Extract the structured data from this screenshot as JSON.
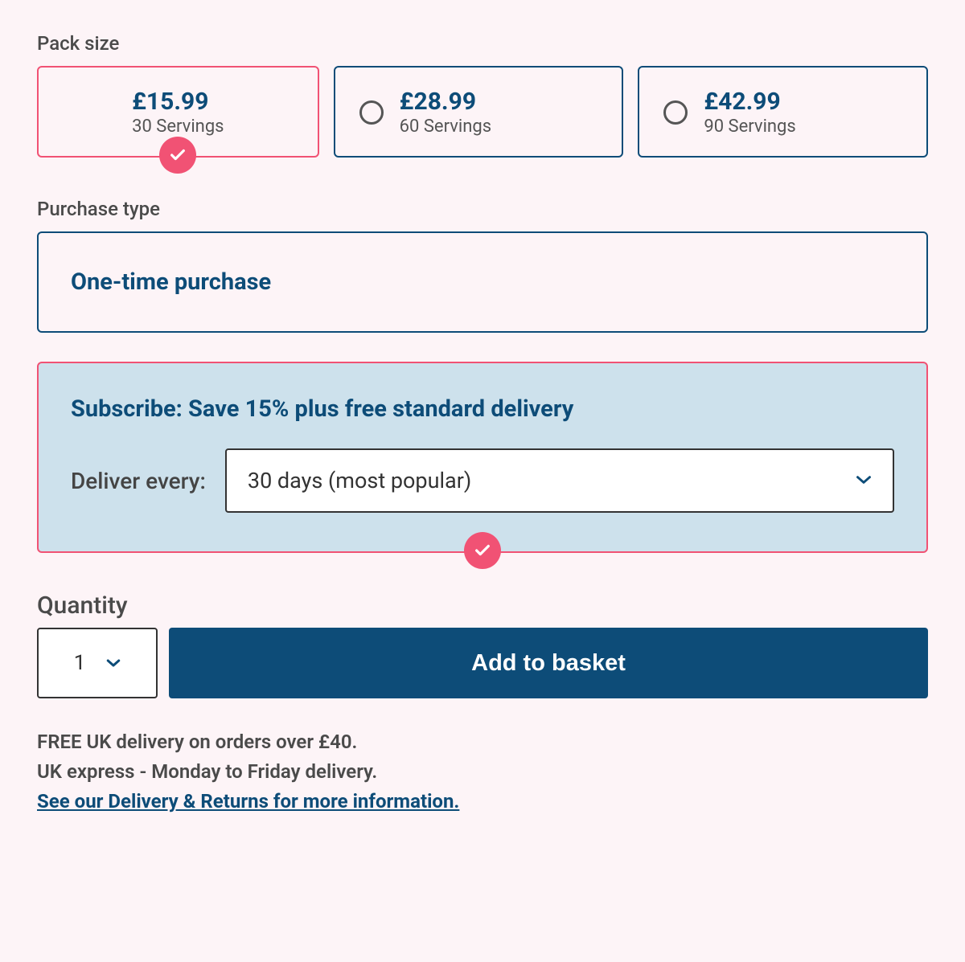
{
  "pack_size": {
    "label": "Pack size",
    "options": [
      {
        "price": "£15.99",
        "servings": "30 Servings"
      },
      {
        "price": "£28.99",
        "servings": "60 Servings"
      },
      {
        "price": "£42.99",
        "servings": "90 Servings"
      }
    ]
  },
  "purchase_type": {
    "label": "Purchase type",
    "one_time": "One-time purchase",
    "subscribe_title": "Subscribe: Save 15% plus free standard delivery",
    "deliver_every_label": "Deliver every:",
    "frequency_selected": "30 days (most popular)"
  },
  "quantity": {
    "label": "Quantity",
    "value": "1"
  },
  "add_button": "Add to basket",
  "delivery": {
    "line1": "FREE UK delivery on orders over £40.",
    "line2": "UK express - Monday to Friday delivery.",
    "link": "See our Delivery & Returns for more information."
  }
}
